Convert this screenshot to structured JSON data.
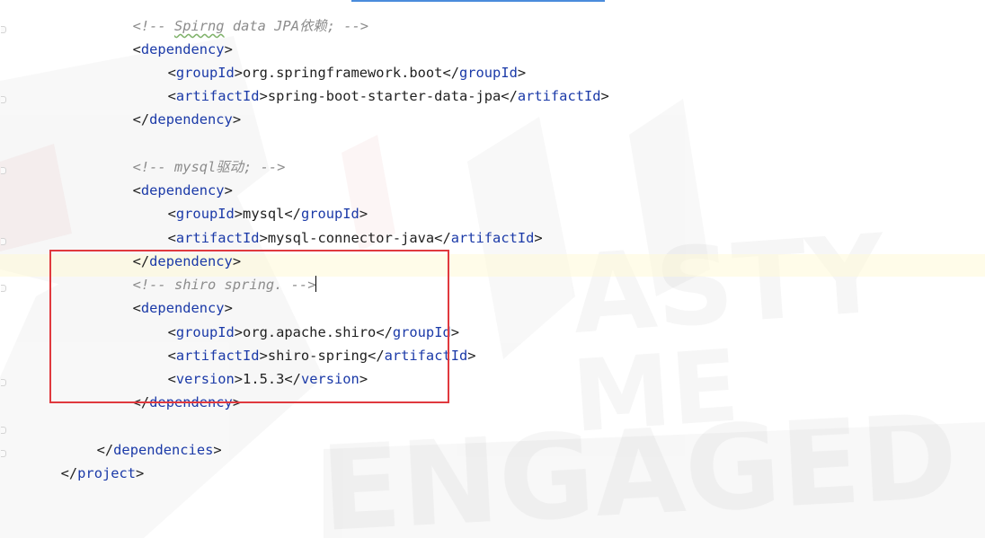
{
  "editor": {
    "accent_tab_color": "#4a8cdc",
    "highlight_color": "#e0393e",
    "lines": [
      {
        "id": "l1",
        "kind": "comment",
        "pre": "<!-- ",
        "word": "Spirng",
        "post": " data JPA依赖; -->"
      },
      {
        "id": "l2",
        "kind": "open",
        "tag": "dependency"
      },
      {
        "id": "l3",
        "kind": "element",
        "tag": "groupId",
        "value": "org.springframework.boot"
      },
      {
        "id": "l4",
        "kind": "element",
        "tag": "artifactId",
        "value": "spring-boot-starter-data-jpa"
      },
      {
        "id": "l5",
        "kind": "close",
        "tag": "dependency"
      },
      {
        "id": "l6",
        "kind": "comment",
        "text": "<!-- mysql驱动; -->"
      },
      {
        "id": "l7",
        "kind": "open",
        "tag": "dependency"
      },
      {
        "id": "l8",
        "kind": "element",
        "tag": "groupId",
        "value": "mysql"
      },
      {
        "id": "l9",
        "kind": "element",
        "tag": "artifactId",
        "value": "mysql-connector-java"
      },
      {
        "id": "l10",
        "kind": "close",
        "tag": "dependency"
      },
      {
        "id": "l11",
        "kind": "comment",
        "text": "<!-- shiro spring. -->"
      },
      {
        "id": "l12",
        "kind": "open",
        "tag": "dependency"
      },
      {
        "id": "l13",
        "kind": "element",
        "tag": "groupId",
        "value": "org.apache.shiro"
      },
      {
        "id": "l14",
        "kind": "element",
        "tag": "artifactId",
        "value": "shiro-spring"
      },
      {
        "id": "l15",
        "kind": "element",
        "tag": "version",
        "value": "1.5.3"
      },
      {
        "id": "l16",
        "kind": "close",
        "tag": "dependency"
      },
      {
        "id": "l17",
        "kind": "close",
        "tag": "dependencies"
      },
      {
        "id": "l18",
        "kind": "close",
        "tag": "project"
      }
    ]
  }
}
